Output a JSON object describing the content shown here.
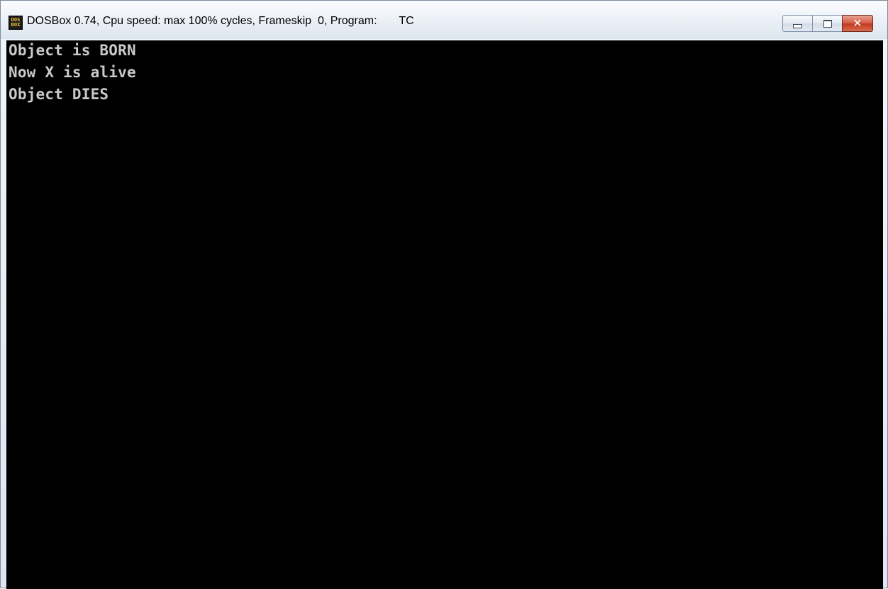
{
  "window": {
    "icon_text_top": "DOS",
    "icon_text_bottom": "BOX",
    "title": "DOSBox 0.74, Cpu speed: max 100% cycles, Frameskip  0, Program:       TC",
    "controls": {
      "minimize_icon": "minimize-icon",
      "maximize_icon": "maximize-icon",
      "close_glyph": "✕"
    }
  },
  "terminal": {
    "background": "#000000",
    "foreground": "#c9c9c9",
    "lines": [
      "Object is BORN",
      "Now X is alive",
      "Object DIES"
    ]
  }
}
